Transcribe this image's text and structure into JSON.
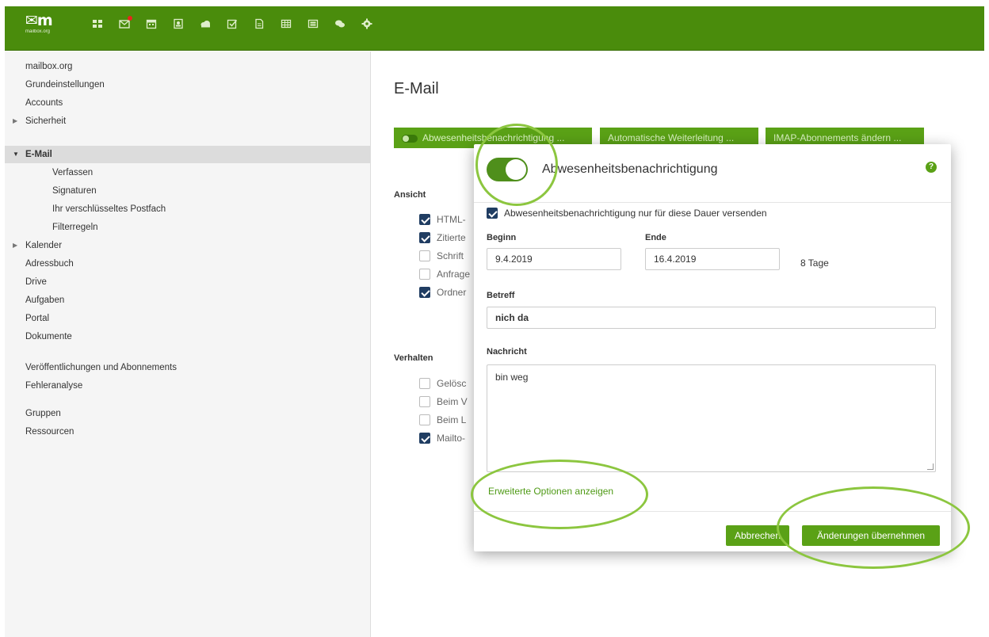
{
  "logo": {
    "mark": "✉m",
    "sub": "mailbox.org"
  },
  "topbar": {
    "icons": [
      "portal-icon",
      "mail-icon",
      "calendar-icon",
      "addressbook-icon",
      "drive-icon",
      "tasks-icon",
      "documents-icon",
      "spreadsheet-icon",
      "presentation-icon",
      "chat-icon",
      "settings-icon"
    ]
  },
  "sidebar": {
    "items": [
      {
        "label": "mailbox.org"
      },
      {
        "label": "Grundeinstellungen"
      },
      {
        "label": "Accounts"
      },
      {
        "label": "Sicherheit"
      },
      {
        "label": "E-Mail"
      },
      {
        "label": "Verfassen"
      },
      {
        "label": "Signaturen"
      },
      {
        "label": "Ihr verschlüsseltes Postfach"
      },
      {
        "label": "Filterregeln"
      },
      {
        "label": "Kalender"
      },
      {
        "label": "Adressbuch"
      },
      {
        "label": "Drive"
      },
      {
        "label": "Aufgaben"
      },
      {
        "label": "Portal"
      },
      {
        "label": "Dokumente"
      },
      {
        "label": "Veröffentlichungen und Abonnements"
      },
      {
        "label": "Fehleranalyse"
      },
      {
        "label": "Gruppen"
      },
      {
        "label": "Ressourcen"
      }
    ]
  },
  "main": {
    "title": "E-Mail",
    "buttons": [
      "Abwesenheitsbenachrichtigung ...",
      "Automatische Weiterleitung ...",
      "IMAP-Abonnements ändern ..."
    ],
    "ansicht": {
      "heading": "Ansicht",
      "items": [
        {
          "label": "HTML-",
          "checked": true
        },
        {
          "label": "Zitierte",
          "checked": true
        },
        {
          "label": "Schrift",
          "checked": false
        },
        {
          "label": "Anfrage",
          "checked": false
        },
        {
          "label": "Ordner",
          "checked": true
        }
      ]
    },
    "verhalten": {
      "heading": "Verhalten",
      "items": [
        {
          "label": "Gelösc",
          "checked": false
        },
        {
          "label": "Beim V",
          "checked": false
        },
        {
          "label": "Beim L",
          "checked": false
        },
        {
          "label": "Mailto-",
          "checked": true
        }
      ]
    }
  },
  "dialog": {
    "title": "Abwesenheitsbenachrichtigung",
    "enabled": true,
    "help": "?",
    "duration_checkbox_label": "Abwesenheitsbenachrichtigung nur für diese Dauer versenden",
    "duration_checked": true,
    "start_label": "Beginn",
    "start_value": "9.4.2019",
    "end_label": "Ende",
    "end_value": "16.4.2019",
    "days": "8 Tage",
    "subject_label": "Betreff",
    "subject_value": "nich da",
    "message_label": "Nachricht",
    "message_value": "bin weg",
    "advanced_link": "Erweiterte Optionen anzeigen",
    "cancel_label": "Abbrechen",
    "apply_label": "Änderungen übernehmen"
  },
  "colors": {
    "brand": "#4a8c0c",
    "button": "#5aa116",
    "toggle": "#4f8f1b",
    "checkbox": "#203d62",
    "annotation": "#8cc63f"
  }
}
